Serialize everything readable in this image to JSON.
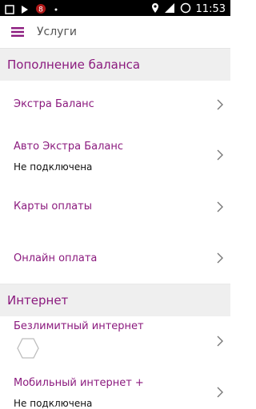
{
  "status_bar": {
    "time": "11:53",
    "icons": [
      "notification-icon",
      "play-icon",
      "badge-8-icon",
      "location-icon",
      "signal-icon",
      "battery-icon"
    ]
  },
  "appbar": {
    "title": "Услуги",
    "menu_icon": "hamburger-icon"
  },
  "colors": {
    "accent": "#8b1a7e",
    "section_bg": "#efefef",
    "divider": "#e9e9e9"
  },
  "sections": [
    {
      "title": "Пополнение баланса",
      "items": [
        {
          "title": "Экстра Баланс"
        },
        {
          "title": "Авто Экстра Баланс",
          "subtitle": "Не подключена"
        },
        {
          "title": "Карты оплаты"
        },
        {
          "title": "Онлайн оплата"
        }
      ]
    },
    {
      "title": "Интернет",
      "items": [
        {
          "title": "Безлимитный интернет",
          "status_icon": "loading-hexagon-icon"
        },
        {
          "title": "Мобильный интернет +",
          "subtitle": "Не подключена"
        }
      ]
    }
  ]
}
